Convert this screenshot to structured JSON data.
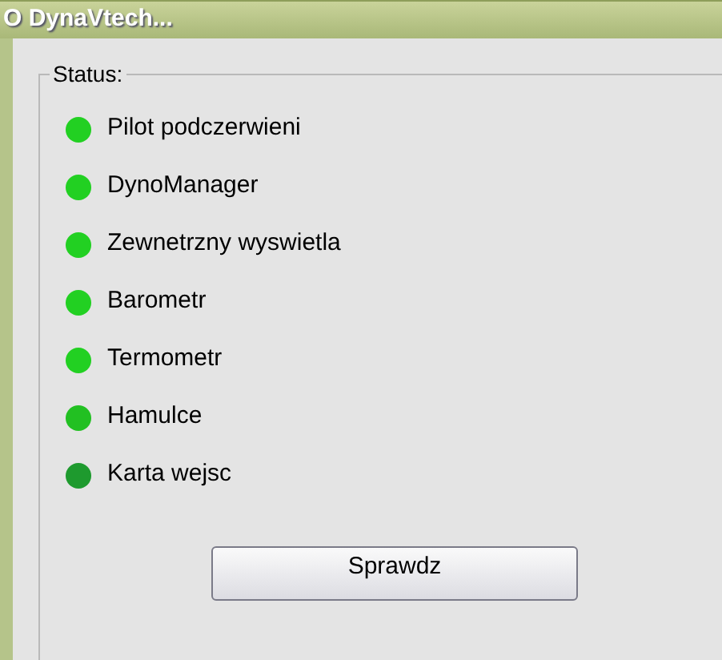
{
  "window": {
    "title": "O DynaVtech..."
  },
  "status_group": {
    "title": "Status:",
    "items": [
      {
        "label": "Pilot podczerwieni",
        "color": "#22d022"
      },
      {
        "label": "DynoManager",
        "color": "#22d022"
      },
      {
        "label": "Zewnetrzny wyswietla",
        "color": "#22d022"
      },
      {
        "label": "Barometr",
        "color": "#22d022"
      },
      {
        "label": "Termometr",
        "color": "#22d022"
      },
      {
        "label": "Hamulce",
        "color": "#22c022"
      },
      {
        "label": "Karta wejsc",
        "color": "#1e9a2e"
      }
    ]
  },
  "buttons": [
    "Sprawdz"
  ]
}
